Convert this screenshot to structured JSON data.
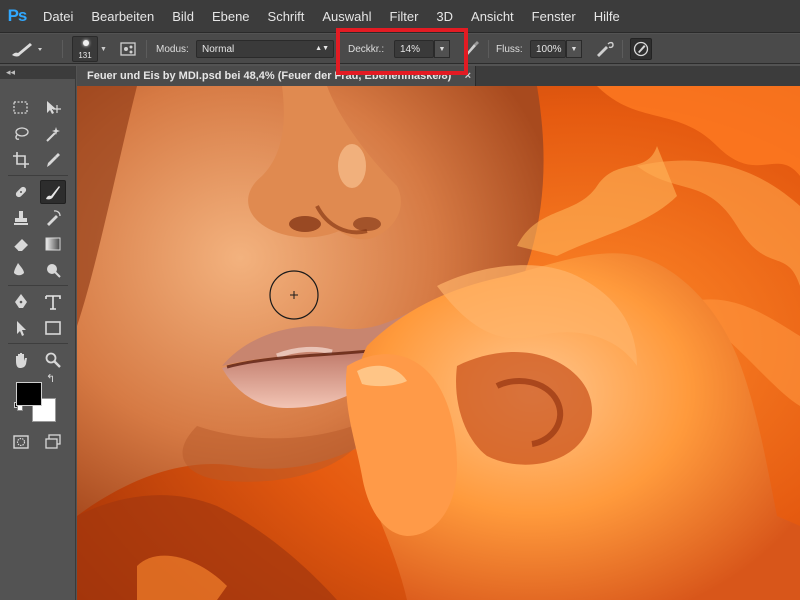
{
  "app": {
    "logo": "Ps"
  },
  "menu": [
    "Datei",
    "Bearbeiten",
    "Bild",
    "Ebene",
    "Schrift",
    "Auswahl",
    "Filter",
    "3D",
    "Ansicht",
    "Fenster",
    "Hilfe"
  ],
  "options": {
    "brush_size": "131",
    "mode_label": "Modus:",
    "mode_value": "Normal",
    "opacity_label": "Deckkr.:",
    "opacity_value": "14%",
    "flow_label": "Fluss:",
    "flow_value": "100%"
  },
  "document": {
    "tab_title": "Feuer und Eis by MDI.psd bei 48,4% (Feuer der Frau, Ebenenmaske/8)",
    "close_glyph": "×"
  },
  "toolpanel": {
    "collapse_glyph": "◂◂"
  },
  "colors": {
    "highlight": "#e31b23",
    "foreground": "#000000",
    "background": "#ffffff"
  }
}
